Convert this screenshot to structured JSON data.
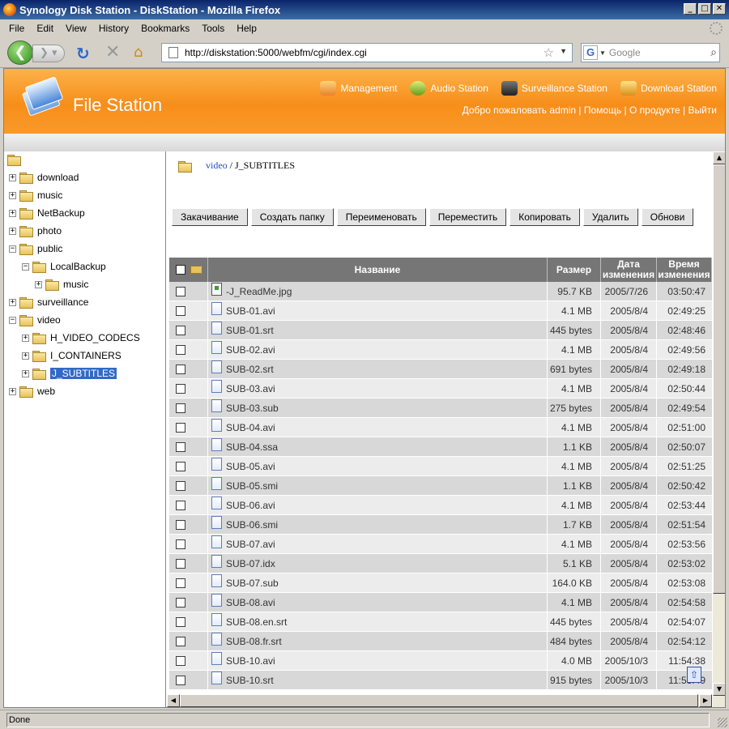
{
  "window": {
    "title": "Synology Disk Station - DiskStation - Mozilla Firefox"
  },
  "menu": [
    "File",
    "Edit",
    "View",
    "History",
    "Bookmarks",
    "Tools",
    "Help"
  ],
  "nav": {
    "url": "http://diskstation:5000/webfm/cgi/index.cgi",
    "search_placeholder": "Google"
  },
  "header": {
    "app_title": "File Station",
    "links": [
      "Management",
      "Audio Station",
      "Surveillance Station",
      "Download Station"
    ],
    "user_links": "Добро пожаловать admin | Помощь | О продукте | Выйти"
  },
  "tree": [
    {
      "label": "download",
      "level": 1,
      "expander": "+"
    },
    {
      "label": "music",
      "level": 1,
      "expander": "+"
    },
    {
      "label": "NetBackup",
      "level": 1,
      "expander": "+"
    },
    {
      "label": "photo",
      "level": 1,
      "expander": "+"
    },
    {
      "label": "public",
      "level": 1,
      "expander": "−"
    },
    {
      "label": "LocalBackup",
      "level": 2,
      "expander": "−"
    },
    {
      "label": "music",
      "level": 3,
      "expander": "+"
    },
    {
      "label": "surveillance",
      "level": 1,
      "expander": "+"
    },
    {
      "label": "video",
      "level": 1,
      "expander": "−"
    },
    {
      "label": "H_VIDEO_CODECS",
      "level": 2,
      "expander": "+"
    },
    {
      "label": "I_CONTAINERS",
      "level": 2,
      "expander": "+"
    },
    {
      "label": "J_SUBTITLES",
      "level": 2,
      "expander": "+",
      "selected": true
    },
    {
      "label": "web",
      "level": 1,
      "expander": "+"
    }
  ],
  "breadcrumb": {
    "parent": "video",
    "current": "/ J_SUBTITLES"
  },
  "toolbar": [
    "Закачивание",
    "Создать папку",
    "Переименовать",
    "Переместить",
    "Копировать",
    "Удалить",
    "Обнови"
  ],
  "columns": {
    "name": "Название",
    "size": "Размер",
    "date": "Дата изменения",
    "time": "Время изменения"
  },
  "files": [
    {
      "name": "-J_ReadMe.jpg",
      "size": "95.7 KB",
      "date": "2005/7/26",
      "time": "03:50:47",
      "type": "image"
    },
    {
      "name": "SUB-01.avi",
      "size": "4.1 MB",
      "date": "2005/8/4",
      "time": "02:49:25",
      "type": "file"
    },
    {
      "name": "SUB-01.srt",
      "size": "445 bytes",
      "date": "2005/8/4",
      "time": "02:48:46",
      "type": "file"
    },
    {
      "name": "SUB-02.avi",
      "size": "4.1 MB",
      "date": "2005/8/4",
      "time": "02:49:56",
      "type": "file"
    },
    {
      "name": "SUB-02.srt",
      "size": "691 bytes",
      "date": "2005/8/4",
      "time": "02:49:18",
      "type": "file"
    },
    {
      "name": "SUB-03.avi",
      "size": "4.1 MB",
      "date": "2005/8/4",
      "time": "02:50:44",
      "type": "file"
    },
    {
      "name": "SUB-03.sub",
      "size": "275 bytes",
      "date": "2005/8/4",
      "time": "02:49:54",
      "type": "file"
    },
    {
      "name": "SUB-04.avi",
      "size": "4.1 MB",
      "date": "2005/8/4",
      "time": "02:51:00",
      "type": "file"
    },
    {
      "name": "SUB-04.ssa",
      "size": "1.1 KB",
      "date": "2005/8/4",
      "time": "02:50:07",
      "type": "file"
    },
    {
      "name": "SUB-05.avi",
      "size": "4.1 MB",
      "date": "2005/8/4",
      "time": "02:51:25",
      "type": "file"
    },
    {
      "name": "SUB-05.smi",
      "size": "1.1 KB",
      "date": "2005/8/4",
      "time": "02:50:42",
      "type": "file"
    },
    {
      "name": "SUB-06.avi",
      "size": "4.1 MB",
      "date": "2005/8/4",
      "time": "02:53:44",
      "type": "file"
    },
    {
      "name": "SUB-06.smi",
      "size": "1.7 KB",
      "date": "2005/8/4",
      "time": "02:51:54",
      "type": "file"
    },
    {
      "name": "SUB-07.avi",
      "size": "4.1 MB",
      "date": "2005/8/4",
      "time": "02:53:56",
      "type": "file"
    },
    {
      "name": "SUB-07.idx",
      "size": "5.1 KB",
      "date": "2005/8/4",
      "time": "02:53:02",
      "type": "file"
    },
    {
      "name": "SUB-07.sub",
      "size": "164.0 KB",
      "date": "2005/8/4",
      "time": "02:53:08",
      "type": "file"
    },
    {
      "name": "SUB-08.avi",
      "size": "4.1 MB",
      "date": "2005/8/4",
      "time": "02:54:58",
      "type": "file"
    },
    {
      "name": "SUB-08.en.srt",
      "size": "445 bytes",
      "date": "2005/8/4",
      "time": "02:54:07",
      "type": "file"
    },
    {
      "name": "SUB-08.fr.srt",
      "size": "484 bytes",
      "date": "2005/8/4",
      "time": "02:54:12",
      "type": "file"
    },
    {
      "name": "SUB-10.avi",
      "size": "4.0 MB",
      "date": "2005/10/3",
      "time": "11:54:38",
      "type": "file"
    },
    {
      "name": "SUB-10.srt",
      "size": "915 bytes",
      "date": "2005/10/3",
      "time": "11:53:49",
      "type": "file"
    }
  ],
  "status": "Done"
}
